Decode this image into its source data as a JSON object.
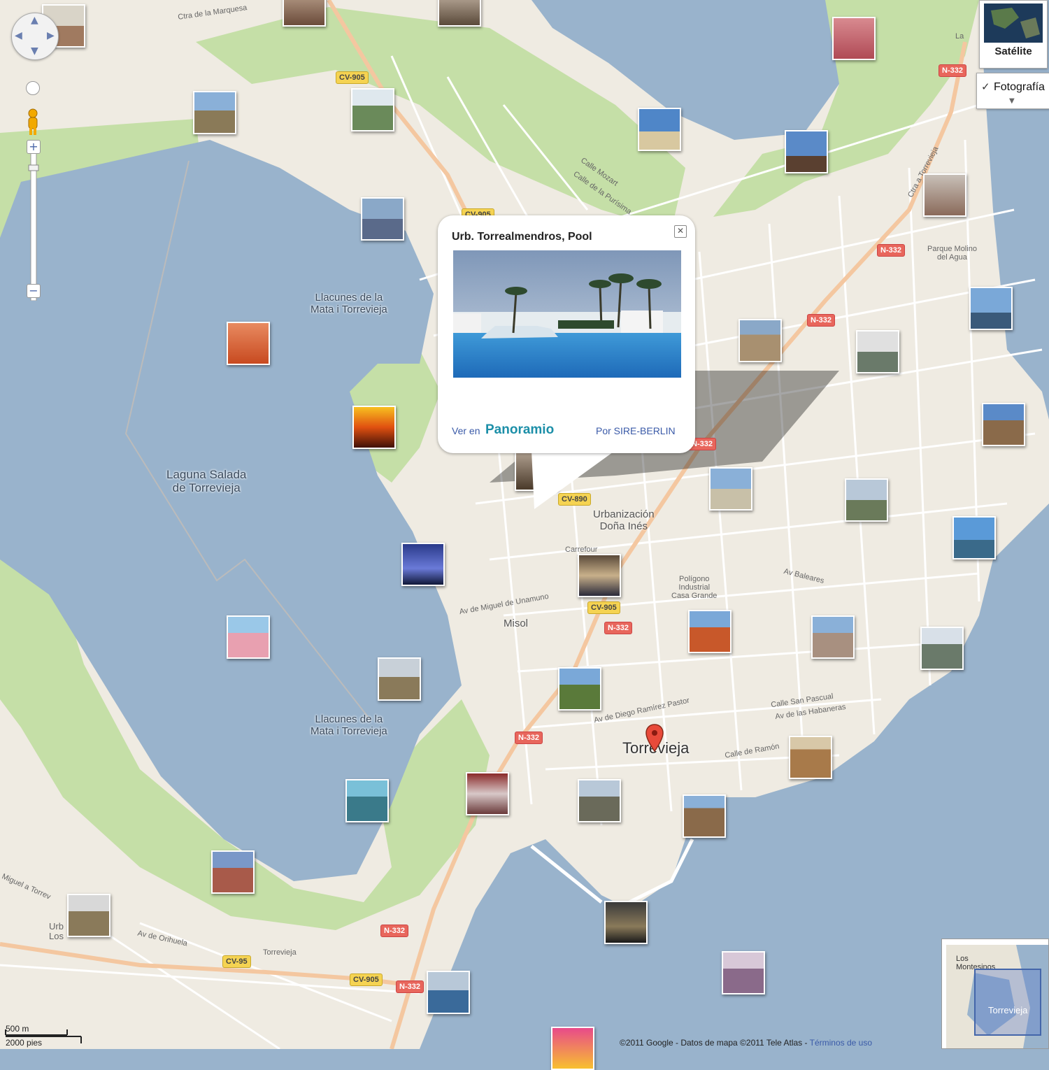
{
  "map": {
    "labels": {
      "lake1": "Laguna Salada\nde Torrevieja",
      "llacunes_top": "Llacunes de la\nMata i Torrevieja",
      "llacunes_bottom": "Llacunes de la\nMata i Torrevieja",
      "urbanizacion": "Urbanización\nDoña Inés",
      "poligono": "Polígono\nIndustrial\nCasa Grande",
      "parque": "Parque Molino\ndel Agua",
      "misol": "Misol",
      "city": "Torrevieja",
      "torrevieja_small": "Torrevieja",
      "urb_los": "Urb\nLos",
      "carrefour": "Carrefour\nTo",
      "st_marquesa": "Ctra de la Marquesa",
      "st_onhuela": "Av de Orihuela",
      "st_miguel": "Av de Miguel de Unamuno",
      "st_diego": "Av de Diego Ramírez Pastor",
      "st_habaneras": "Av de las Habaneras",
      "st_pascual": "Calle San Pascual",
      "st_baleares": "Av Baleares",
      "st_mozart": "Calle Mozart",
      "st_purisima": "Calle de la Purísima",
      "st_ramon": "Calle de Ramón",
      "st_toreros": "Ctra a Torrevieja",
      "st_miguel_torre": "Miguel a Torrev",
      "st_la": "La"
    },
    "shields": {
      "cv905_top": "CV-905",
      "cv905_mid": "CV-905",
      "cv905_low": "CV-905",
      "cv95": "CV-95",
      "cv905_bot": "CV-905",
      "cv890": "CV-890",
      "n332_a": "N-332",
      "n332_b": "N-332",
      "n332_c": "N-332",
      "n332_d": "N-332",
      "n332_e": "N-332",
      "n332_f": "N-332",
      "n332_g": "N-332",
      "n332_h": "N-332"
    }
  },
  "controls": {
    "pan_up": "▲",
    "pan_down": "▼",
    "pan_left": "◀",
    "pan_right": "▶",
    "zoom_in": "+",
    "zoom_out": "−",
    "map_type": "Satélite",
    "photos_check": "✓",
    "photos_label": "Fotografía",
    "photos_more": "▼"
  },
  "popup": {
    "title": "Urb. Torrealmendros, Pool",
    "close": "✕",
    "ver_en": "Ver en",
    "panoramio": "Panoramio",
    "by": "Por SIRE-BERLIN"
  },
  "footer": {
    "scale_m": "500 m",
    "scale_ft": "2000 pies",
    "copyright": "©2011 Google - Datos de mapa ©2011 Tele Atlas - ",
    "terms": "Términos de uso"
  },
  "overview": {
    "label1": "Los\nMontesinos",
    "label2": "Torrevieja"
  },
  "colors": {
    "water": "#99b3cc",
    "land": "#efebe2",
    "park": "#c5dfa7",
    "highway": "#f4c7a0",
    "shield_red": "#e8665c",
    "shield_yellow": "#f5d352",
    "link": "#3a5aa8"
  }
}
